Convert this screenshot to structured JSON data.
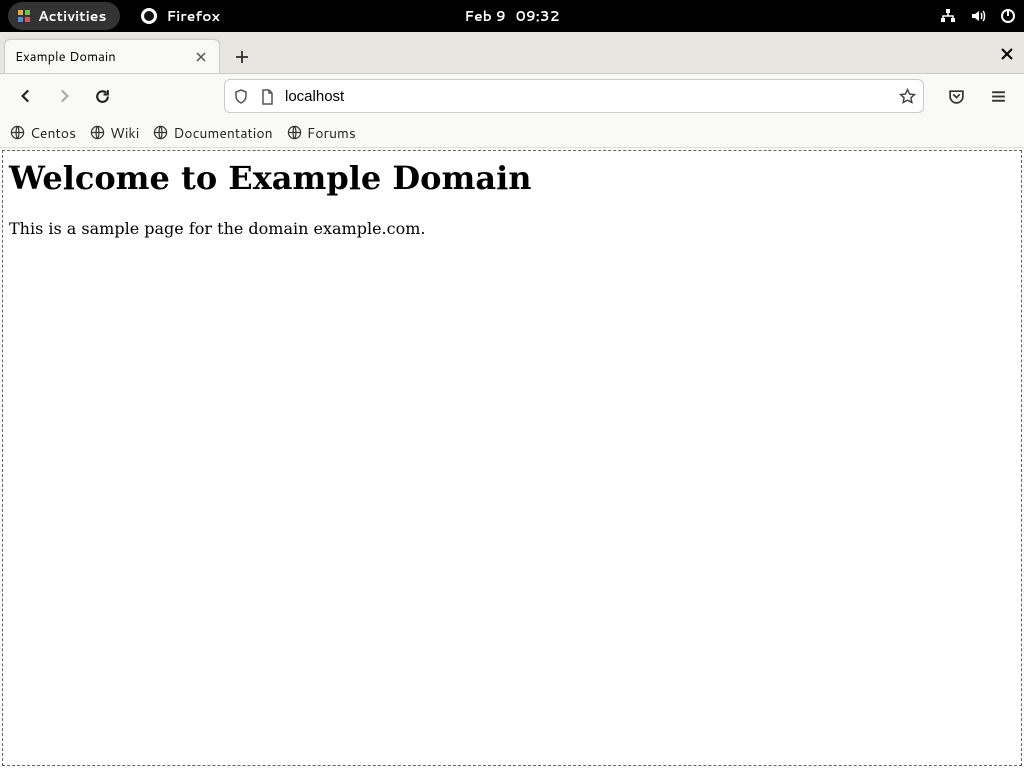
{
  "topbar": {
    "activities": "Activities",
    "app_name": "Firefox",
    "date": "Feb 9",
    "time": "09:32"
  },
  "tab": {
    "title": "Example Domain"
  },
  "urlbar": {
    "value": "localhost"
  },
  "bookmarks": [
    {
      "label": "Centos"
    },
    {
      "label": "Wiki"
    },
    {
      "label": "Documentation"
    },
    {
      "label": "Forums"
    }
  ],
  "page": {
    "heading": "Welcome to Example Domain",
    "paragraph": "This is a sample page for the domain example.com."
  }
}
